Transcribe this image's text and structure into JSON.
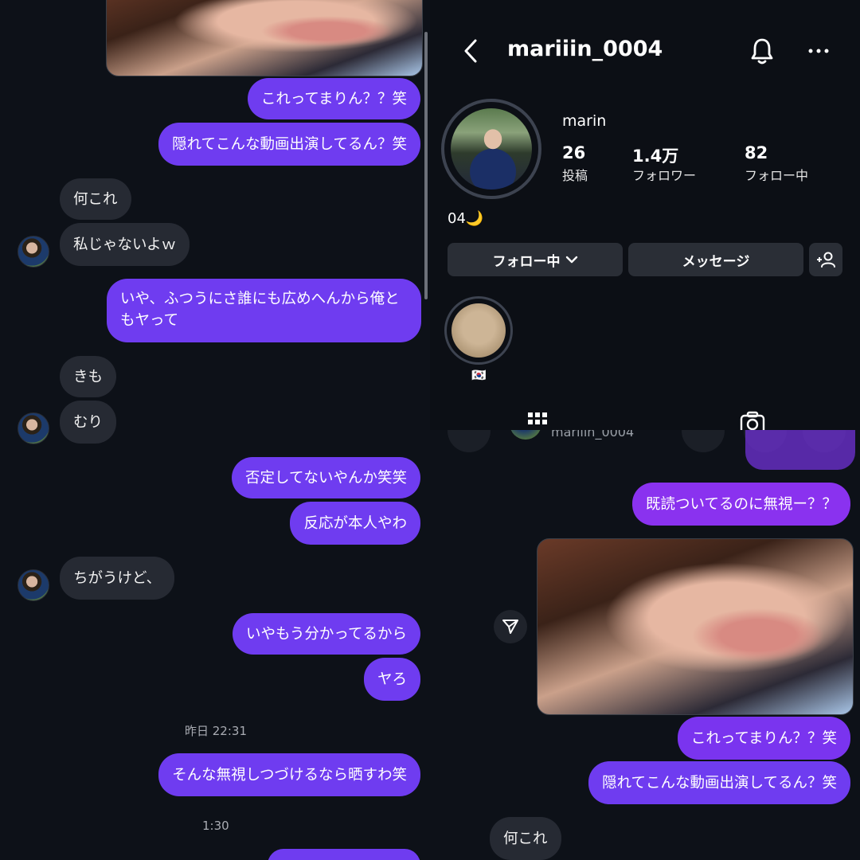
{
  "colors": {
    "sent": "#6f3cf0",
    "received": "#262a33",
    "background": "#0d1118"
  },
  "left_chat": {
    "messages": [
      {
        "from": "me",
        "text": "これってまりん？？笑"
      },
      {
        "from": "me",
        "text": "隠れてこんな動画出演してるん？笑"
      },
      {
        "from": "them",
        "text": "何これ"
      },
      {
        "from": "them",
        "text": "私じゃないよｗ"
      },
      {
        "from": "me",
        "text": "いや、ふつうにさ誰にも広めへんから俺ともヤって"
      },
      {
        "from": "them",
        "text": "きも"
      },
      {
        "from": "them",
        "text": "むり"
      },
      {
        "from": "me",
        "text": "否定してないやんか笑笑"
      },
      {
        "from": "me",
        "text": "反応が本人やわ"
      },
      {
        "from": "them",
        "text": "ちがうけど、"
      },
      {
        "from": "me",
        "text": "いやもう分かってるから"
      },
      {
        "from": "me",
        "text": "ヤろ"
      },
      {
        "from": "me",
        "text": "そんな無視しつづけるなら晒すわ笑"
      }
    ],
    "timestamps": [
      "昨日 22:31",
      "1:30"
    ]
  },
  "profile": {
    "username": "mariiin_0004",
    "display_name": "marin",
    "stats": [
      {
        "value": "26",
        "label": "投稿"
      },
      {
        "value": "1.4万",
        "label": "フォロワー"
      },
      {
        "value": "82",
        "label": "フォロー中"
      }
    ],
    "bio": "04🌙",
    "buttons": {
      "following": "フォロー中",
      "message": "メッセージ"
    },
    "highlight_label": "🇰🇷",
    "icons": [
      "back-icon",
      "bell-icon",
      "more-icon",
      "add-person-icon",
      "grid-icon",
      "tag-icon"
    ]
  },
  "right_chat": {
    "header_username": "mariiin_0004",
    "messages": [
      {
        "from": "me",
        "text": "既読ついてるのに無視ー？？"
      },
      {
        "from": "me",
        "text": "これってまりん？？笑"
      },
      {
        "from": "me",
        "text": "隠れてこんな動画出演してるん？笑"
      },
      {
        "from": "them",
        "text": "何これ"
      }
    ]
  }
}
